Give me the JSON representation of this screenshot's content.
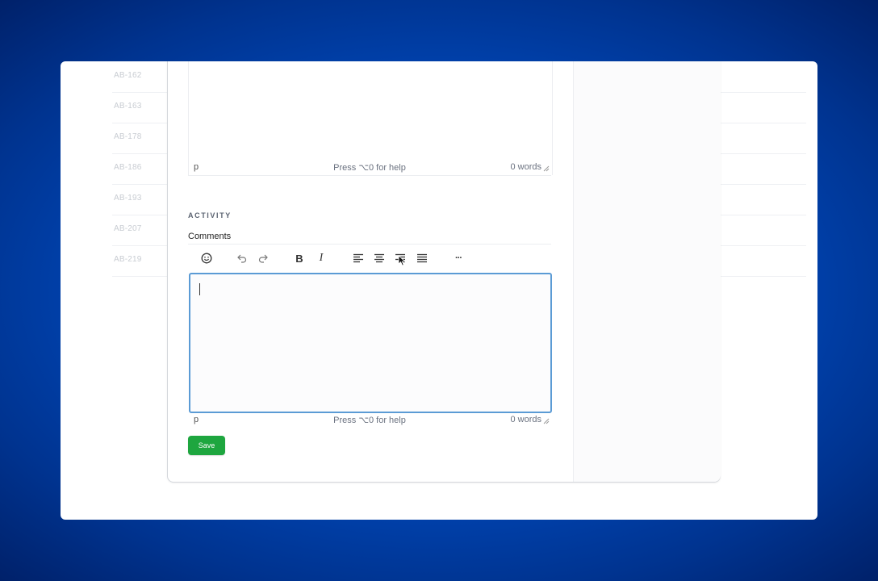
{
  "background_list": {
    "rows": [
      "AB-162",
      "AB-163",
      "AB-178",
      "AB-186",
      "AB-193",
      "AB-207",
      "AB-219"
    ]
  },
  "description_editor": {
    "status": {
      "element": "p",
      "help": "Press ⌥0 for help",
      "word_count": "0 words"
    }
  },
  "activity": {
    "section_title": "ACTIVITY",
    "comments_label": "Comments",
    "toolbar": [
      {
        "name": "emoji-icon"
      },
      {
        "name": "undo-icon"
      },
      {
        "name": "redo-icon"
      },
      {
        "name": "bold-icon",
        "glyph": "B"
      },
      {
        "name": "italic-icon",
        "glyph": "I"
      },
      {
        "name": "align-left-icon"
      },
      {
        "name": "align-center-icon"
      },
      {
        "name": "align-right-icon"
      },
      {
        "name": "align-justify-icon"
      },
      {
        "name": "more-icon",
        "glyph": "···"
      }
    ],
    "comment_editor": {
      "value": "",
      "status": {
        "element": "p",
        "help": "Press ⌥0 for help",
        "word_count": "0 words"
      }
    },
    "save_label": "Save"
  },
  "colors": {
    "accent_focus": "#5b9bd5",
    "save_button": "#1ea63f",
    "background": "#0047b8"
  }
}
